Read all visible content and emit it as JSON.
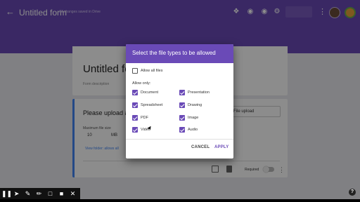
{
  "header": {
    "title": "Untitled form",
    "save_status": "All changes saved in Drive",
    "icons": [
      "back-arrow-icon",
      "puzzle-icon",
      "palette-icon",
      "eye-icon",
      "gear-icon",
      "more-vert-icon",
      "avatar",
      "google-account-icon"
    ],
    "accent_color": "#6a4ab7"
  },
  "form": {
    "title": "Untitled form",
    "description_placeholder": "Form description",
    "question": {
      "text": "Please upload a f",
      "type": "File upload",
      "max_size_label": "Maximum file size",
      "max_size_value": "10",
      "max_size_unit": "MB",
      "view_link": "View folder: allows all",
      "required_label": "Required",
      "required": false
    }
  },
  "dialog": {
    "title": "Select the file types to be allowed",
    "allow_all": {
      "label": "Allow all files",
      "checked": false
    },
    "allow_only_label": "Allow only:",
    "types": [
      {
        "label": "Document",
        "checked": true
      },
      {
        "label": "Presentation",
        "checked": true
      },
      {
        "label": "Spreadsheet",
        "checked": true
      },
      {
        "label": "Drawing",
        "checked": true
      },
      {
        "label": "PDF",
        "checked": true
      },
      {
        "label": "Image",
        "checked": true
      },
      {
        "label": "Video",
        "checked": true
      },
      {
        "label": "Audio",
        "checked": true
      }
    ],
    "cancel_label": "CANCEL",
    "apply_label": "APPLY"
  },
  "toolbar": {
    "icons": [
      "pause-icon",
      "pointer-icon",
      "pen-icon",
      "highlighter-icon",
      "rectangle-icon",
      "camera-icon",
      "close-icon"
    ]
  },
  "help_icon": "help-icon"
}
